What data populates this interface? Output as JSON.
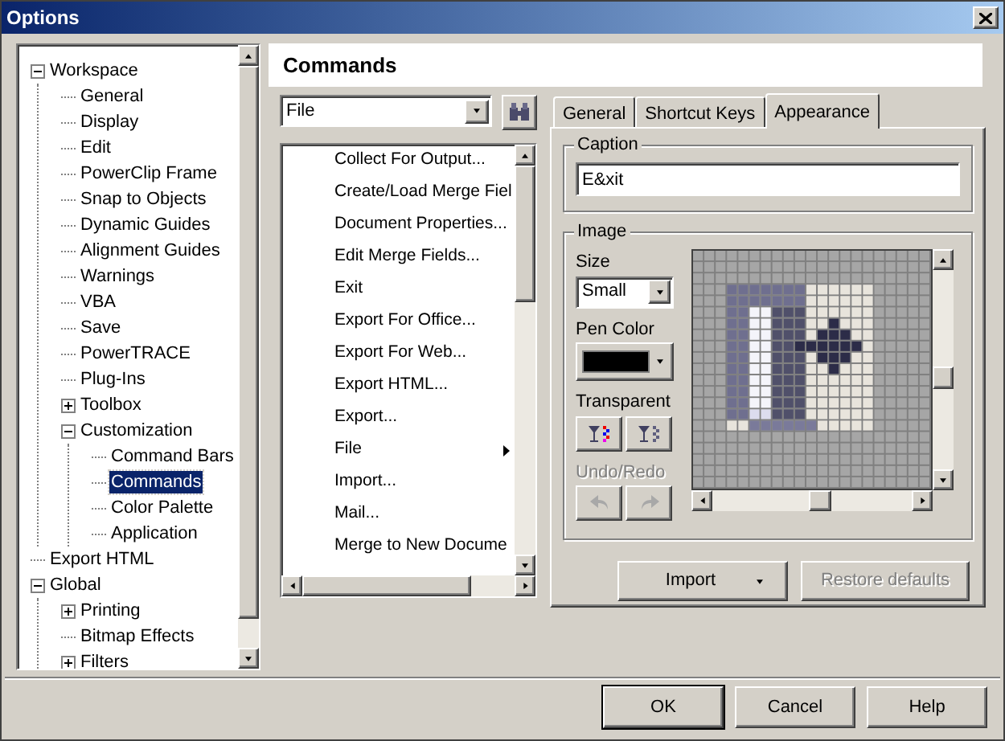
{
  "window": {
    "title": "Options"
  },
  "tree": [
    {
      "label": "Workspace",
      "expanded": true,
      "selected": false,
      "children": [
        {
          "label": "General",
          "selected": false
        },
        {
          "label": "Display",
          "selected": false
        },
        {
          "label": "Edit",
          "selected": false
        },
        {
          "label": "PowerClip Frame",
          "selected": false
        },
        {
          "label": "Snap to Objects",
          "selected": false
        },
        {
          "label": "Dynamic Guides",
          "selected": false
        },
        {
          "label": "Alignment Guides",
          "selected": false
        },
        {
          "label": "Warnings",
          "selected": false
        },
        {
          "label": "VBA",
          "selected": false
        },
        {
          "label": "Save",
          "selected": false
        },
        {
          "label": "PowerTRACE",
          "selected": false
        },
        {
          "label": "Plug-Ins",
          "selected": false
        },
        {
          "label": "Toolbox",
          "expanded": false,
          "selected": false
        },
        {
          "label": "Customization",
          "expanded": true,
          "selected": false,
          "children": [
            {
              "label": "Command Bars",
              "selected": false
            },
            {
              "label": "Commands",
              "selected": true
            },
            {
              "label": "Color Palette",
              "selected": false
            },
            {
              "label": "Application",
              "selected": false
            }
          ]
        }
      ]
    },
    {
      "label": "Export HTML",
      "selected": false
    },
    {
      "label": "Global",
      "expanded": true,
      "selected": false,
      "children": [
        {
          "label": "Printing",
          "expanded": false,
          "selected": false
        },
        {
          "label": "Bitmap Effects",
          "selected": false
        },
        {
          "label": "Filters",
          "expanded": false,
          "selected": false
        }
      ]
    }
  ],
  "header": "Commands",
  "category_select": {
    "value": "File"
  },
  "commands": [
    {
      "label": "Collect For Output...",
      "submenu": false
    },
    {
      "label": "Create/Load Merge Fiel",
      "submenu": false
    },
    {
      "label": "Document Properties...",
      "submenu": false
    },
    {
      "label": "Edit Merge Fields...",
      "submenu": false
    },
    {
      "label": "Exit",
      "submenu": false
    },
    {
      "label": "Export For Office...",
      "submenu": false
    },
    {
      "label": "Export For Web...",
      "submenu": false
    },
    {
      "label": "Export HTML...",
      "submenu": false
    },
    {
      "label": "Export...",
      "submenu": false
    },
    {
      "label": "File",
      "submenu": true
    },
    {
      "label": "Import...",
      "submenu": false
    },
    {
      "label": "Mail...",
      "submenu": false
    },
    {
      "label": "Merge to New Docume",
      "submenu": false
    }
  ],
  "tabs": [
    {
      "label": "General",
      "selected": false
    },
    {
      "label": "Shortcut Keys",
      "selected": false
    },
    {
      "label": "Appearance",
      "selected": true
    }
  ],
  "caption": {
    "label": "Caption",
    "value": "E&xit"
  },
  "image": {
    "label": "Image",
    "size_label": "Size",
    "size_value": "Small",
    "pen_color_label": "Pen Color",
    "transparent_label": "Transparent",
    "undo_redo": {
      "label": "Undo/Redo",
      "disabled": true
    }
  },
  "import_button": {
    "label": "Import",
    "disabled": false
  },
  "restore_button": {
    "label": "Restore defaults",
    "disabled": true
  },
  "footer_buttons": [
    {
      "label": "OK",
      "default": true
    },
    {
      "label": "Cancel",
      "default": false
    },
    {
      "label": "Help",
      "default": false
    }
  ]
}
